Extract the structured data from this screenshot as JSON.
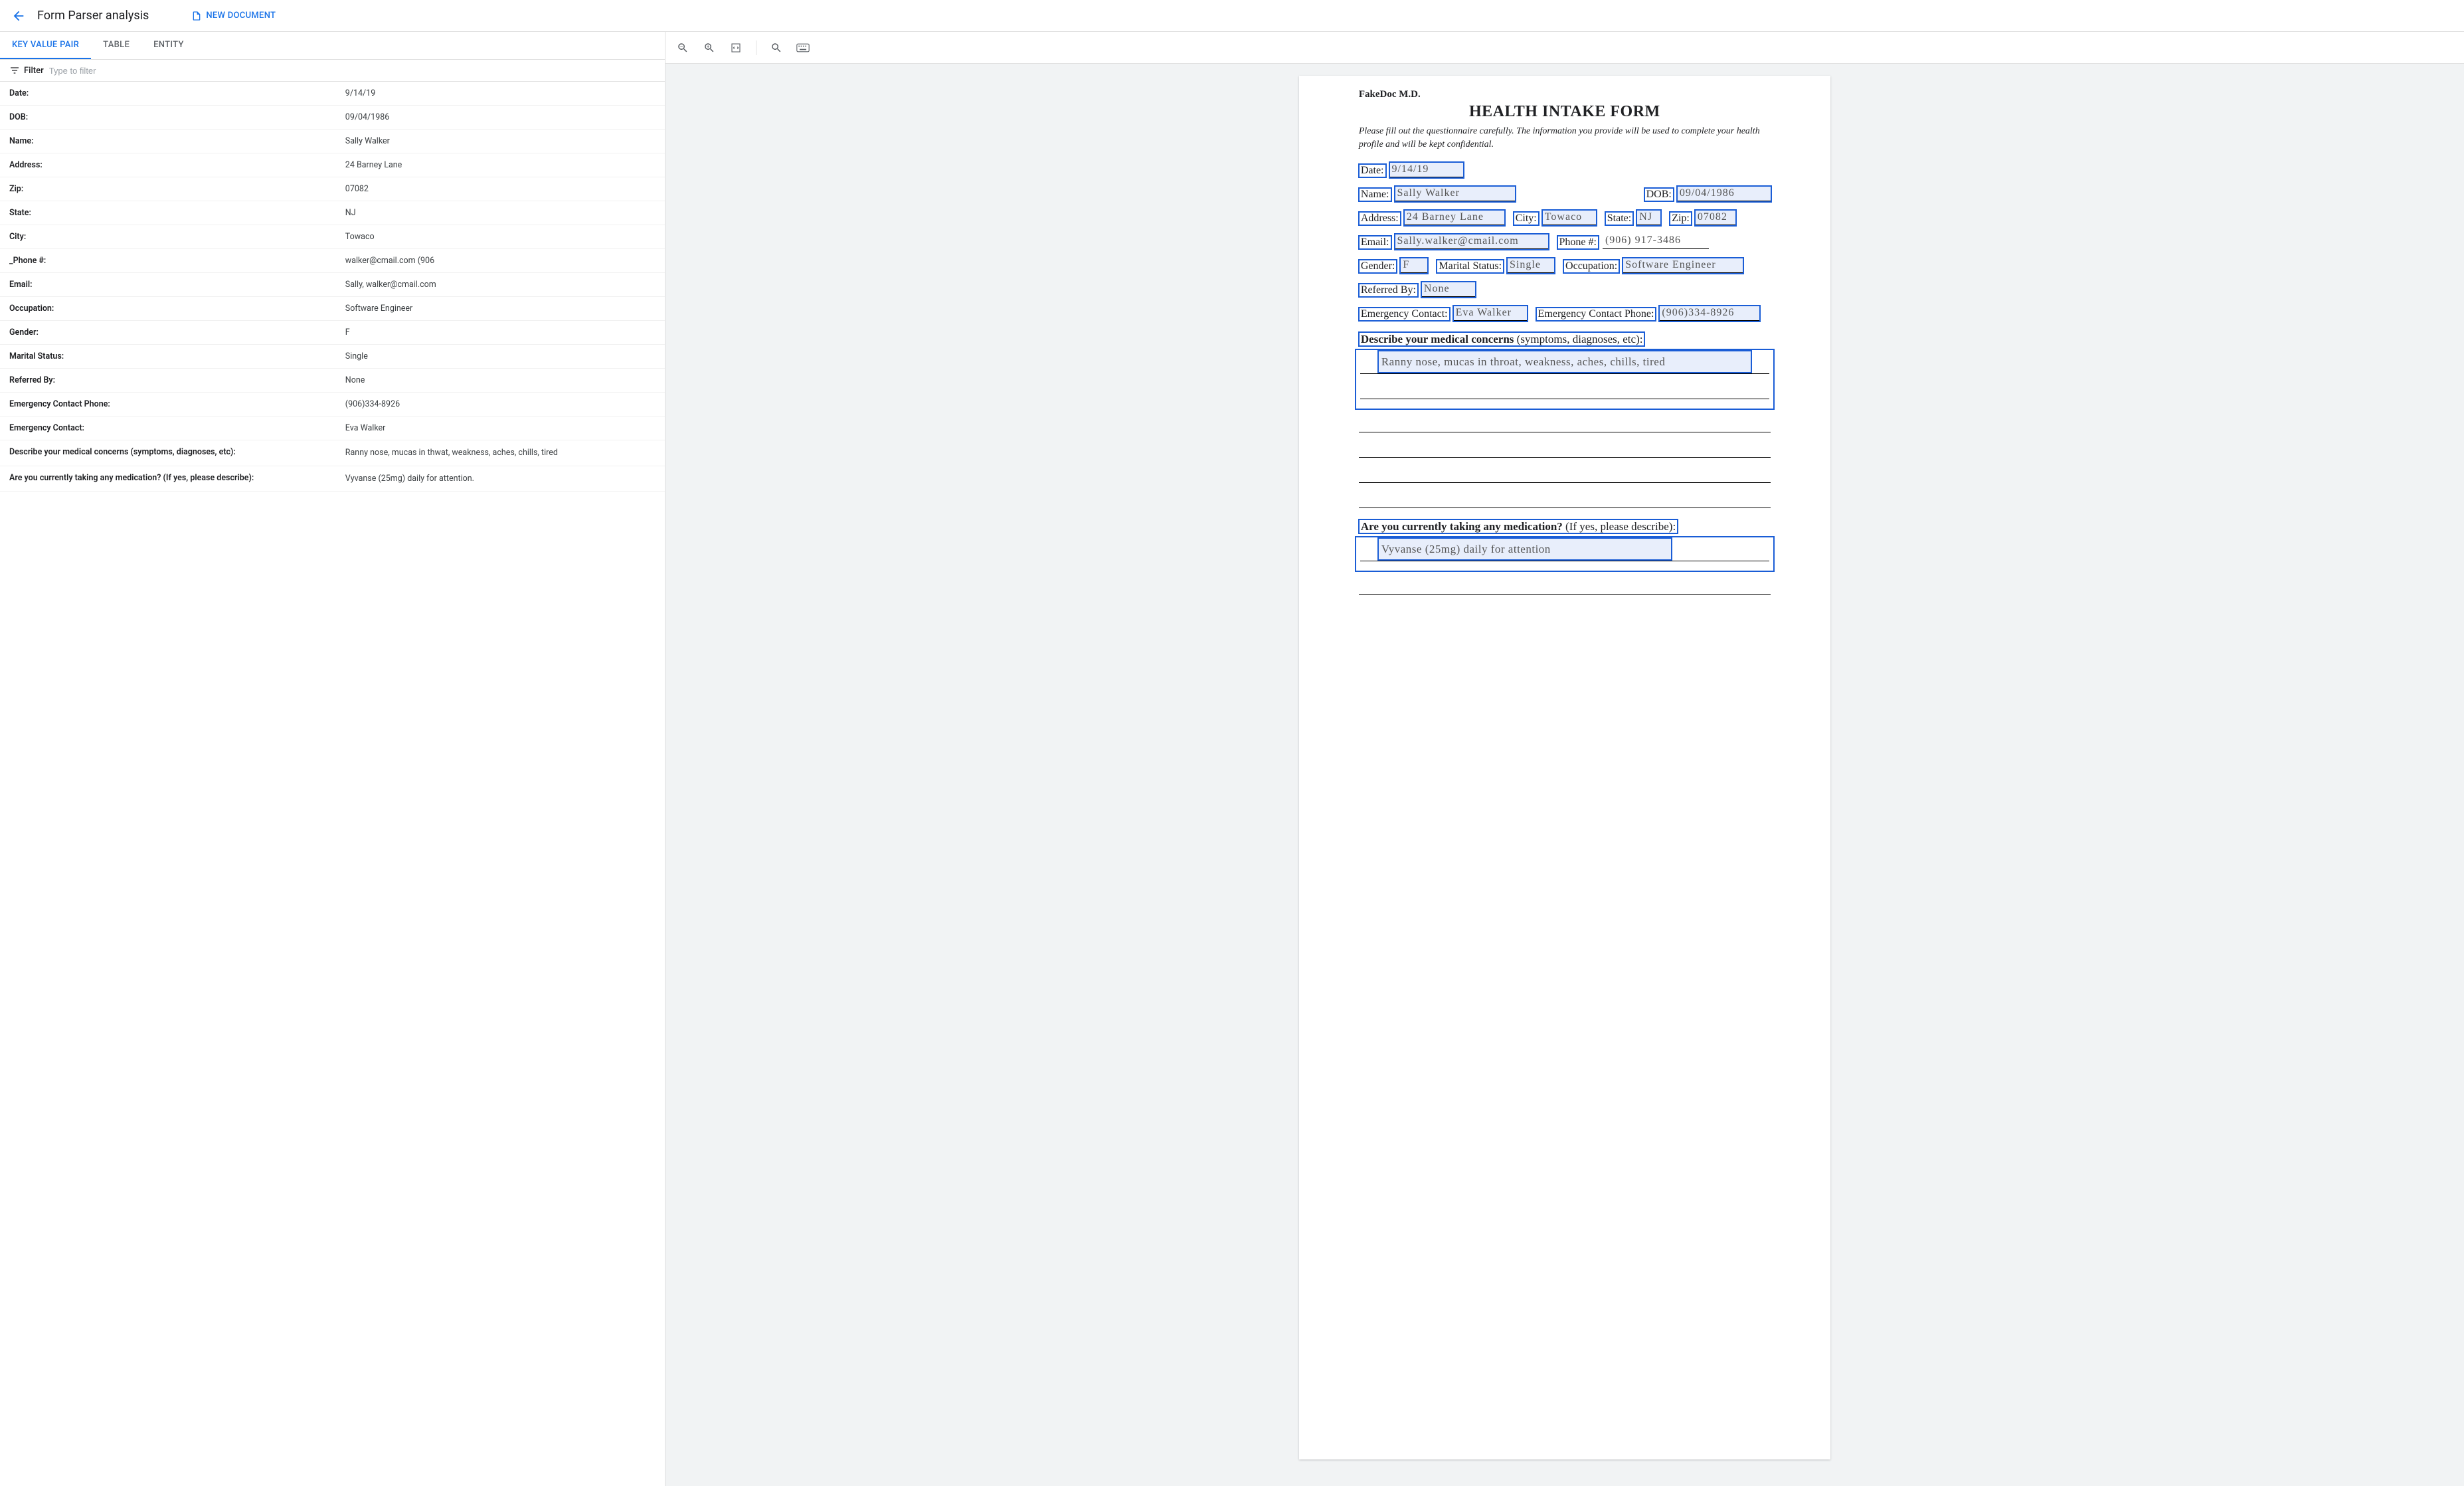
{
  "header": {
    "title": "Form Parser analysis",
    "new_doc_label": "NEW DOCUMENT"
  },
  "tabs": [
    {
      "id": "kv",
      "label": "KEY VALUE PAIR",
      "active": true
    },
    {
      "id": "table",
      "label": "TABLE",
      "active": false
    },
    {
      "id": "entity",
      "label": "ENTITY",
      "active": false
    }
  ],
  "filter": {
    "label": "Filter",
    "placeholder": "Type to filter"
  },
  "kv_pairs": [
    {
      "k": "Date:",
      "v": "9/14/19"
    },
    {
      "k": "DOB:",
      "v": "09/04/1986"
    },
    {
      "k": "Name:",
      "v": "Sally Walker"
    },
    {
      "k": "Address:",
      "v": "24 Barney Lane"
    },
    {
      "k": "Zip:",
      "v": "07082"
    },
    {
      "k": "State:",
      "v": "NJ"
    },
    {
      "k": "City:",
      "v": "Towaco"
    },
    {
      "k": "_Phone #:",
      "v": "walker@cmail.com (906"
    },
    {
      "k": "Email:",
      "v": "Sally, walker@cmail.com"
    },
    {
      "k": "Occupation:",
      "v": "Software Engineer"
    },
    {
      "k": "Gender:",
      "v": "F"
    },
    {
      "k": "Marital Status:",
      "v": "Single"
    },
    {
      "k": "Referred By:",
      "v": "None"
    },
    {
      "k": "Emergency Contact Phone:",
      "v": "(906)334-8926"
    },
    {
      "k": "Emergency Contact:",
      "v": "Eva Walker"
    },
    {
      "k": "Describe your medical concerns (symptoms, diagnoses, etc):",
      "v": "Ranny nose, mucas in thwat, weakness, aches, chills, tired"
    },
    {
      "k": "Are you currently taking any medication? (If yes, please describe):",
      "v": "Vyvanse (25mg) daily for attention."
    }
  ],
  "doc": {
    "office": "FakeDoc M.D.",
    "title": "HEALTH INTAKE FORM",
    "subtitle": "Please fill out the questionnaire carefully. The information you provide will be used to complete your health profile and will be kept confidential.",
    "fields": {
      "date_label": "Date:",
      "date_val": "9/14/19",
      "name_label": "Name:",
      "name_val": "Sally Walker",
      "dob_label": "DOB:",
      "dob_val": "09/04/1986",
      "address_label": "Address:",
      "address_val": "24 Barney Lane",
      "city_label": "City:",
      "city_val": "Towaco",
      "state_label": "State:",
      "state_val": "NJ",
      "zip_label": "Zip:",
      "zip_val": "07082",
      "email_label": "Email:",
      "email_val": "Sally.walker@cmail.com",
      "phone_label": "Phone #:",
      "phone_val": "(906) 917-3486",
      "gender_label": "Gender:",
      "gender_val": "F",
      "ms_label": "Marital Status:",
      "ms_val": "Single",
      "occ_label": "Occupation:",
      "occ_val": "Software Engineer",
      "ref_label": "Referred By:",
      "ref_val": "None",
      "ec_label": "Emergency Contact:",
      "ec_val": "Eva Walker",
      "ecp_label": "Emergency Contact Phone:",
      "ecp_val": "(906)334-8926",
      "concerns_label_b": "Describe your medical concerns",
      "concerns_label_r": " (symptoms, diagnoses, etc):",
      "concerns_val": "Ranny nose, mucas in throat, weakness, aches, chills, tired",
      "med_label_b": "Are you currently taking any medication?",
      "med_label_r": " (If yes, please describe):",
      "med_val": "Vyvanse (25mg) daily for attention"
    }
  },
  "colors": {
    "accent": "#1a73e8",
    "highlight": "#1a5dd6"
  }
}
